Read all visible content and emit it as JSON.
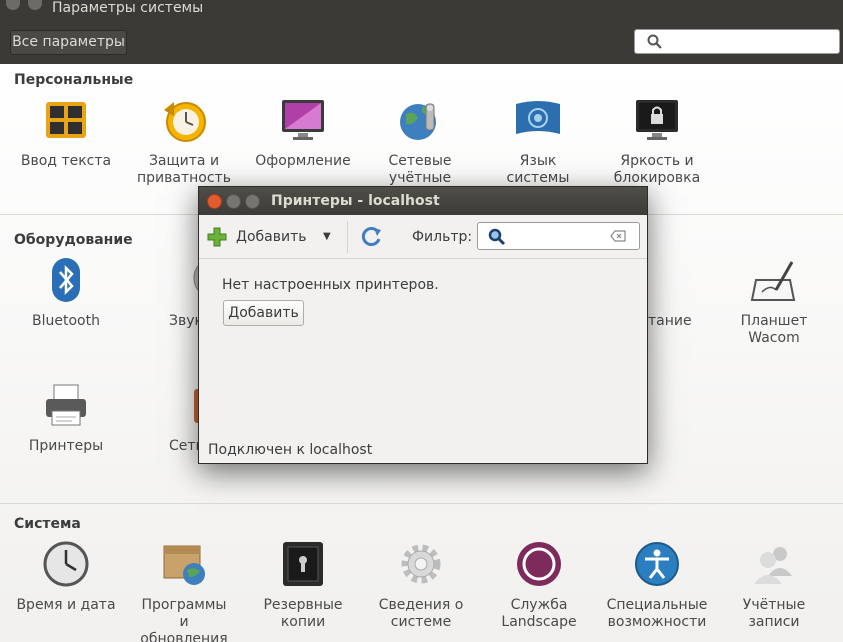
{
  "window": {
    "title": "Параметры системы",
    "all_settings_label": "Все параметры",
    "search_placeholder": ""
  },
  "sections": {
    "personal": {
      "title": "Персональные",
      "items": [
        {
          "label": "Ввод текста",
          "icon": "keyboard-icon"
        },
        {
          "label": "Защита и\nприватность",
          "icon": "privacy-clock-icon"
        },
        {
          "label": "Оформление",
          "icon": "appearance-monitor-icon"
        },
        {
          "label": "Сетевые\nучётные",
          "icon": "online-accounts-icon"
        },
        {
          "label": "Язык\nсистемы",
          "icon": "language-flag-icon"
        },
        {
          "label": "Яркость и\nблокировка",
          "icon": "lock-screen-icon"
        }
      ]
    },
    "hardware": {
      "title": "Оборудование",
      "items": [
        {
          "label": "Bluetooth",
          "icon": "bluetooth-icon"
        },
        {
          "label": "Звук",
          "icon": "sound-icon"
        },
        {
          "label": "тание",
          "icon": "power-icon"
        },
        {
          "label": "Планшет\nWacom",
          "icon": "wacom-tablet-icon"
        },
        {
          "label": "Принтеры",
          "icon": "printer-icon"
        },
        {
          "label": "Сеть",
          "icon": "network-icon"
        }
      ]
    },
    "system": {
      "title": "Система",
      "items": [
        {
          "label": "Время и дата",
          "icon": "clock-icon"
        },
        {
          "label": "Программы\nи\nобновления",
          "icon": "software-updates-icon"
        },
        {
          "label": "Резервные\nкопии",
          "icon": "backup-safe-icon"
        },
        {
          "label": "Сведения о\nсистеме",
          "icon": "gear-icon"
        },
        {
          "label": "Служба\nLandscape",
          "icon": "landscape-icon"
        },
        {
          "label": "Специальные\nвозможности",
          "icon": "accessibility-icon"
        },
        {
          "label": "Учётные\nзаписи",
          "icon": "users-icon"
        }
      ]
    }
  },
  "dialog": {
    "title": "Принтеры - localhost",
    "add_label": "Добавить",
    "filter_label": "Фильтр:",
    "filter_value": "",
    "message": "Нет настроенных принтеров.",
    "add_button_label": "Добавить",
    "status": "Подключен к localhost"
  },
  "colors": {
    "topbar": "#3b3a36",
    "close_button": "#e35b2e",
    "landscape": "#7d2a5c",
    "accessibility": "#2b7fc1"
  }
}
